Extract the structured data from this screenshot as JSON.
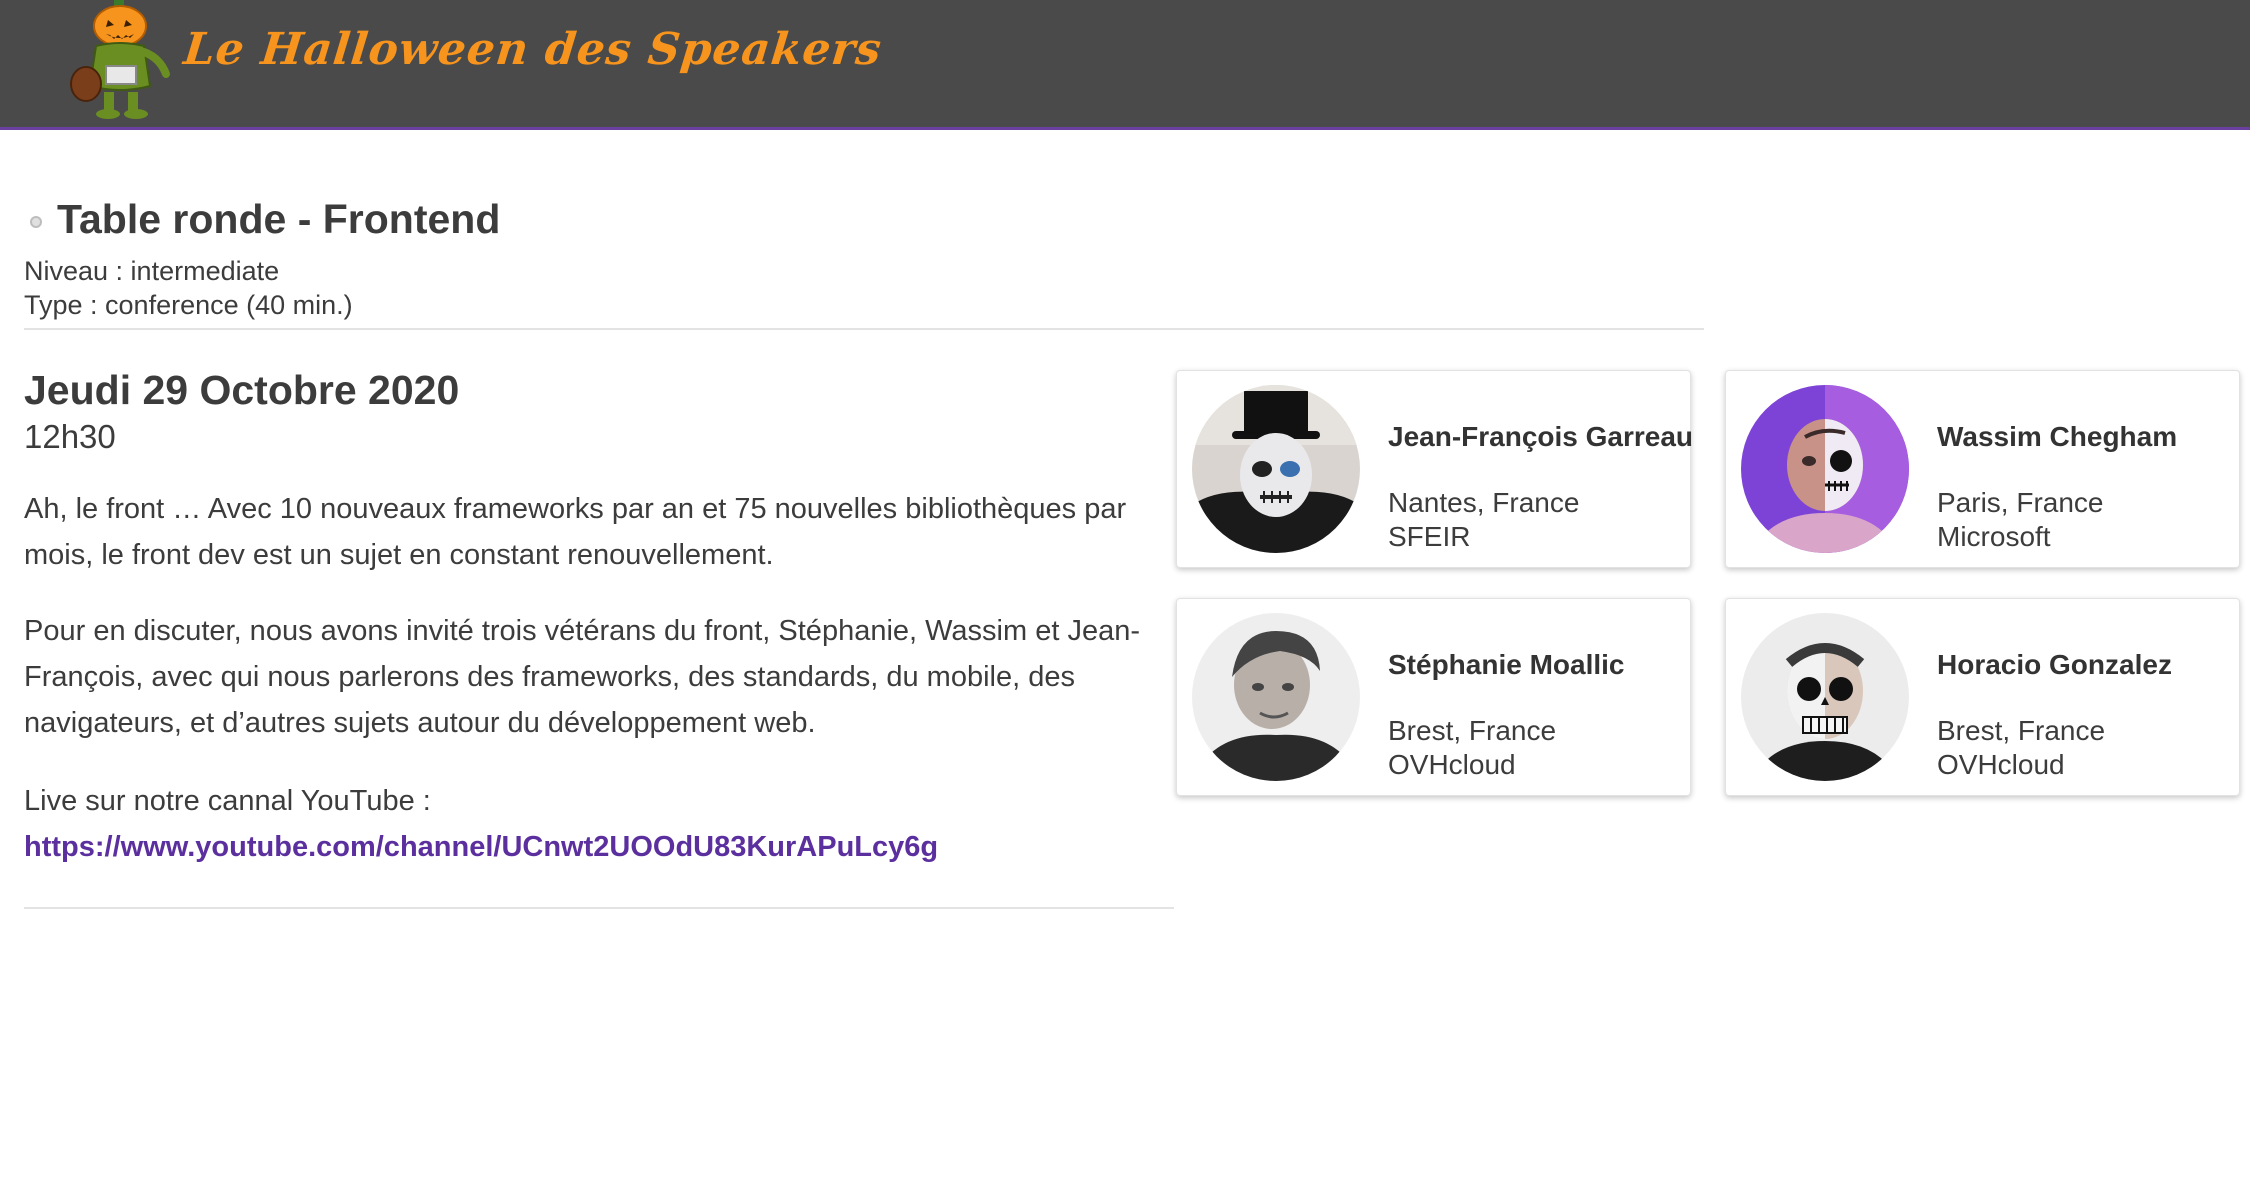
{
  "header": {
    "brand": "Le Halloween des Speakers",
    "logo_icon": "pumpkin-monster-mascot-icon",
    "background_color": "#4a4a4a",
    "brand_color": "#f7941d",
    "accent_color": "#6b3fa0"
  },
  "talk": {
    "title": "Table ronde - Frontend",
    "level": "Niveau : intermediate",
    "type": "Type : conference (40 min.)",
    "date": "Jeudi 29 Octobre 2020",
    "time": "12h30",
    "description": [
      "Ah, le front … Avec 10 nouveaux frameworks par an et 75 nouvelles bibliothèques par mois, le front dev est un sujet en constant renouvellement.",
      "Pour en discuter, nous avons invité trois vétérans du front, Stéphanie, Wassim et Jean-François, avec qui nous parlerons des frameworks, des standards, du mobile, des navigateurs, et d’autres sujets autour du développement web."
    ],
    "live_label": "Live sur notre cannal YouTube :",
    "live_url": "https://www.youtube.com/channel/UCnwt2UOOdU83KurAPuLcy6g",
    "link_color": "#5b2f9e"
  },
  "speakers": [
    {
      "name": "Jean-François Garreau",
      "city": "Nantes, France",
      "company": "SFEIR",
      "avatar_icon": "speaker-photo-top-hat-skull-makeup"
    },
    {
      "name": "Wassim Chegham",
      "city": "Paris, France",
      "company": "Microsoft",
      "avatar_icon": "speaker-photo-half-skull-purple"
    },
    {
      "name": "Stéphanie Moallic",
      "city": "Brest, France",
      "company": "OVHcloud",
      "avatar_icon": "speaker-photo-portrait"
    },
    {
      "name": "Horacio Gonzalez",
      "city": "Brest, France",
      "company": "OVHcloud",
      "avatar_icon": "speaker-photo-skull-makeup"
    }
  ]
}
